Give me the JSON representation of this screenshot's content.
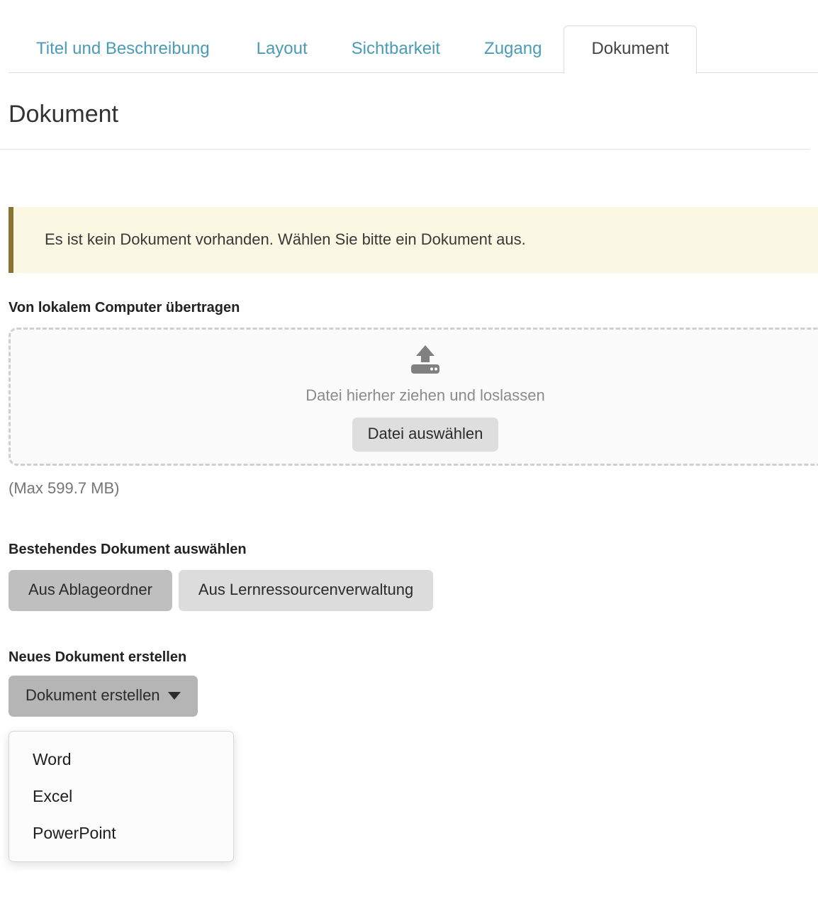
{
  "tabs": [
    {
      "label": "Titel und Beschreibung",
      "active": false
    },
    {
      "label": "Layout",
      "active": false
    },
    {
      "label": "Sichtbarkeit",
      "active": false
    },
    {
      "label": "Zugang",
      "active": false
    },
    {
      "label": "Dokument",
      "active": true
    }
  ],
  "page": {
    "title": "Dokument"
  },
  "alert": {
    "message": "Es ist kein Dokument vorhanden. Wählen Sie bitte ein Dokument aus.",
    "background_color": "#faf8e3",
    "border_color": "#8a7235"
  },
  "upload": {
    "section_label": "Von lokalem Computer übertragen",
    "icon": "upload-to-drive-icon",
    "drop_text": "Datei hierher ziehen und loslassen",
    "choose_button": "Datei auswählen",
    "max_size": "(Max 599.7 MB)"
  },
  "existing": {
    "section_label": "Bestehendes Dokument auswählen",
    "buttons": [
      {
        "label": "Aus Ablageordner",
        "color": "#bfbfbf"
      },
      {
        "label": "Aus Lernressourcenverwaltung",
        "color": "#dcdcdc"
      }
    ]
  },
  "create": {
    "section_label": "Neues Dokument erstellen",
    "button_label": "Dokument erstellen",
    "menu_items": [
      "Word",
      "Excel",
      "PowerPoint"
    ]
  },
  "colors": {
    "tab_link": "#4a9bb7",
    "tab_active_text": "#444444",
    "heading": "#333333",
    "muted_text": "#767676"
  }
}
